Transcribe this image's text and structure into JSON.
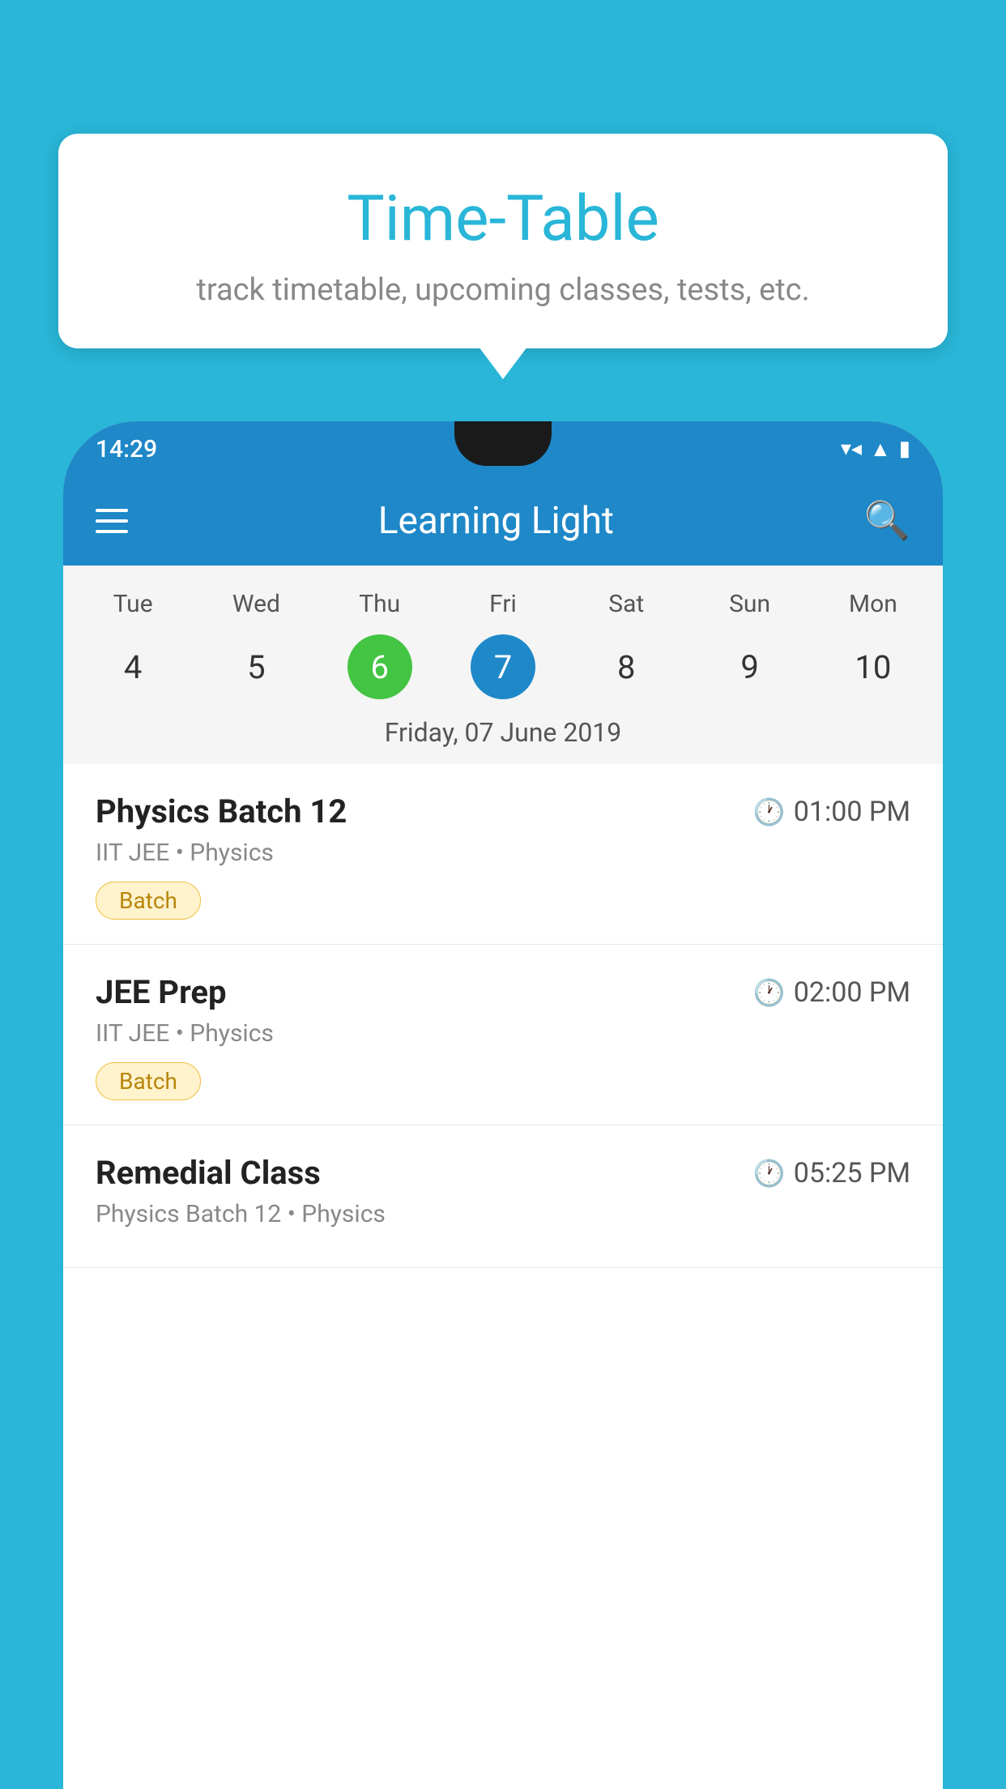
{
  "page": {
    "background_color": "#29B6D8"
  },
  "tooltip": {
    "title": "Time-Table",
    "subtitle": "track timetable, upcoming classes, tests, etc."
  },
  "status_bar": {
    "time": "14:29"
  },
  "app_bar": {
    "title": "Learning Light",
    "menu_icon": "menu-icon",
    "search_icon": "search-icon"
  },
  "calendar": {
    "days": [
      "Tue",
      "Wed",
      "Thu",
      "Fri",
      "Sat",
      "Sun",
      "Mon"
    ],
    "dates": [
      "4",
      "5",
      "6",
      "7",
      "8",
      "9",
      "10"
    ],
    "today_index": 2,
    "selected_index": 3,
    "selected_date_label": "Friday, 07 June 2019"
  },
  "sessions": [
    {
      "title": "Physics Batch 12",
      "time": "01:00 PM",
      "meta": "IIT JEE • Physics",
      "tag": "Batch"
    },
    {
      "title": "JEE Prep",
      "time": "02:00 PM",
      "meta": "IIT JEE • Physics",
      "tag": "Batch"
    },
    {
      "title": "Remedial Class",
      "time": "05:25 PM",
      "meta": "Physics Batch 12 • Physics",
      "tag": ""
    }
  ]
}
